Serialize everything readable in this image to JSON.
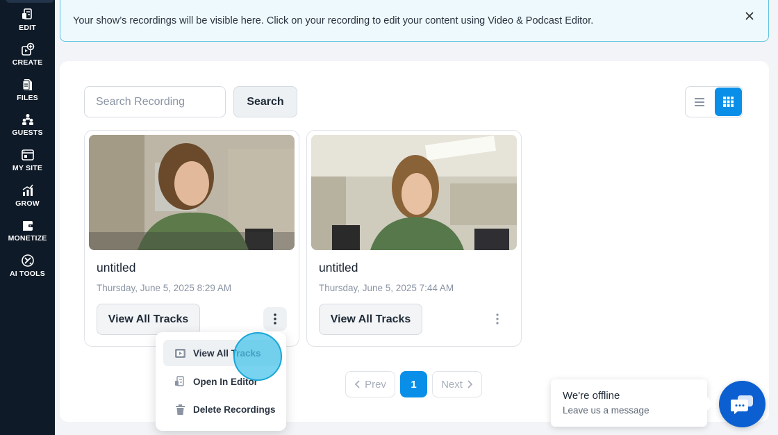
{
  "sidebar": {
    "items": [
      {
        "label": "EDIT",
        "icon": "edit-icon"
      },
      {
        "label": "CREATE",
        "icon": "create-icon"
      },
      {
        "label": "FILES",
        "icon": "files-icon"
      },
      {
        "label": "GUESTS",
        "icon": "guests-icon"
      },
      {
        "label": "MY SITE",
        "icon": "site-icon"
      },
      {
        "label": "GROW",
        "icon": "chart-icon"
      },
      {
        "label": "MONETIZE",
        "icon": "monetize-icon"
      },
      {
        "label": "AI TOOLS",
        "icon": "ai-tools-icon"
      }
    ]
  },
  "banner": {
    "text": "Your show’s recordings will be visible here. Click on your recording to edit your content using Video & Podcast Editor."
  },
  "search": {
    "placeholder": "Search Recording",
    "button_label": "Search"
  },
  "view_toggle": {
    "options": [
      "list-view",
      "grid-view"
    ],
    "active": "grid-view"
  },
  "recordings": [
    {
      "title": "untitled",
      "date": "Thursday, June 5, 2025 8:29 AM",
      "button_label": "View All Tracks"
    },
    {
      "title": "untitled",
      "date": "Thursday, June 5, 2025 7:44 AM",
      "button_label": "View All Tracks"
    }
  ],
  "context_menu": {
    "items": [
      {
        "label": "View All Tracks",
        "icon": "play-icon"
      },
      {
        "label": "Open In Editor",
        "icon": "editor-icon"
      },
      {
        "label": "Delete Recordings",
        "icon": "trash-icon"
      }
    ]
  },
  "pagination": {
    "prev": "Prev",
    "current": "1",
    "next": "Next"
  },
  "chat": {
    "status": "We're offline",
    "prompt": "Leave us a message"
  },
  "colors": {
    "accent": "#0a8fe8",
    "sidebar": "#0f1a28",
    "chat": "#0c5fd0",
    "banner_border": "#5fc4e0"
  }
}
